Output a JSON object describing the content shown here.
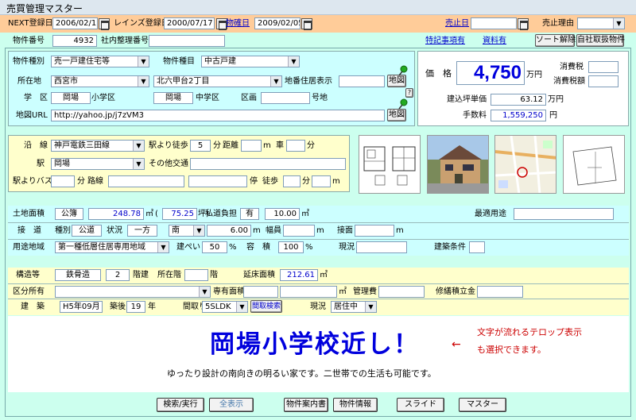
{
  "window": {
    "title": "売買管理マスター"
  },
  "top": {
    "next_label": "NEXT登録日",
    "next_value": "2006/02/17",
    "reins_label": "レインズ登録日",
    "reins_value": "2000/07/17",
    "bukken_date_label": "物確日",
    "bukken_date_value": "2009/02/05",
    "sold_date_label": "売止日",
    "sold_date_value": "",
    "sold_reason_label": "売止理由",
    "sold_reason_value": ""
  },
  "row2": {
    "id_label": "物件番号",
    "id_value": "4932",
    "internal_label": "社内整理番号",
    "internal_value": "",
    "special_link": "特記事項有",
    "docs_link": "資料有",
    "sort_btn": "ソート解除",
    "own_btn": "自社取扱物件"
  },
  "info": {
    "type_label": "物件種別",
    "type_value": "売一戸建住宅等",
    "kind_label": "物件種目",
    "kind_value": "中古戸建",
    "loc_label": "所在地",
    "city_value": "西宮市",
    "town_value": "北六甲台2丁目",
    "chiban_label": "地番住居表示",
    "chiban_value": "",
    "map_btn": "地図",
    "help": "?",
    "school_label": "学　区",
    "school1": "岡場",
    "school1_suffix": "小学区",
    "school2": "岡場",
    "school2_suffix": "中学区",
    "kukaku_label": "区画",
    "kukaku_value": "",
    "gochi_label": "号地",
    "url_label": "地図URL",
    "url_value": "http://yahoo.jp/j7zVM3",
    "map_btn2": "地図"
  },
  "price": {
    "label": "価　格",
    "value": "4,750",
    "unit": "万円",
    "tax_label": "消費税",
    "tax_value": "",
    "tax_amt_label": "消費税額",
    "tax_amt_value": "",
    "tsubo_label": "建込坪単価",
    "tsubo_value": "63.12",
    "tsubo_unit": "万円",
    "fee_label": "手数料",
    "fee_value": "1,559,250",
    "fee_unit": "円"
  },
  "transit": {
    "line_label": "沿　線",
    "line_value": "神戸電鉄三田線",
    "walk_label": "駅より徒歩",
    "walk_value": "5",
    "walk_unit": "分",
    "dist_label": "距離",
    "dist_value": "",
    "dist_unit": "m",
    "car_label": "車",
    "car_value": "",
    "car_unit": "分",
    "station_label": "駅",
    "station_value": "岡場",
    "other_label": "その他交通",
    "other_value": "",
    "bus_label": "駅よりバス",
    "bus_value": "",
    "bus_unit": "分",
    "route_label": "路線",
    "route_value": "",
    "route_value2": "",
    "stop_label": "停",
    "stopwalk_label": "徒歩",
    "stopwalk_value": "",
    "stopwalk_unit": "分",
    "stopm_value": "",
    "stopm_unit": "m"
  },
  "land": {
    "area_label": "土地面積",
    "area_type": "公簿",
    "area_value": "248.78",
    "area_unit": "㎡",
    "paren_open": "(",
    "tsubo_value": "75.25",
    "tsubo_unit": "坪)",
    "private_label": "私道負担",
    "private_value": "有",
    "private_area": "10.00",
    "private_unit": "㎡",
    "best_use_label": "最適用途",
    "best_use_value": "",
    "road_label": "接　道",
    "kind_label": "種別",
    "kind_value": "公道",
    "status_label": "状況",
    "status_value": "一方",
    "dir_value": "南",
    "road_width": "6.00",
    "road_unit": "m",
    "width_label": "幅員",
    "width_value": "",
    "width_unit": "m",
    "frontage_label": "接面",
    "frontage_value": "",
    "frontage_unit": "m",
    "zone_label": "用途地域",
    "zone_value": "第一種低層住居専用地域",
    "bcr_label": "建ぺい",
    "bcr_value": "50",
    "bcr_unit": "%",
    "far_label": "容　積",
    "far_value": "100",
    "far_unit": "%",
    "current_label": "現況",
    "current_value": "",
    "cond_label": "建築条件",
    "cond_value": ""
  },
  "building": {
    "struct_label": "構造等",
    "struct_value": "鉄骨造",
    "floors_value": "2",
    "floors_label": "階建",
    "floor_at_label": "所在階",
    "floor_at_value": "",
    "floor_at_unit": "階",
    "total_label": "延床面積",
    "total_value": "212.61",
    "total_unit": "㎡",
    "owner_label": "区分所有",
    "owner_value": "",
    "exclusive_label": "専有面積",
    "exclusive_value": "",
    "exclusive_unit": "㎡",
    "mgmt_label": "管理費",
    "mgmt_value": "",
    "repair_label": "修繕積立金",
    "repair_value": "",
    "built_label": "建　築",
    "built_value": "H5年09月",
    "age_label": "築後",
    "age_value": "19",
    "age_unit": "年",
    "layout_label": "間取り",
    "layout_value": "5SLDK",
    "layout_btn": "間取検索",
    "status_label": "現況",
    "status_value": "居住中"
  },
  "headline": {
    "main": "岡場小学校近し！",
    "note_line1": "文字が流れるテロップ表示",
    "note_line2": "も選択できます。",
    "arrow": "←",
    "desc": "ゆったり設計の南向きの明るい家です。二世帯での生活も可能です。"
  },
  "buttons": {
    "search": "検索/実行",
    "show_all": "全表示",
    "guide": "物件案内書",
    "info": "物件情報",
    "slide": "スライド",
    "master": "マスター"
  },
  "colors": {
    "accent_blue": "#0000dd",
    "note_red": "#cc0000"
  }
}
